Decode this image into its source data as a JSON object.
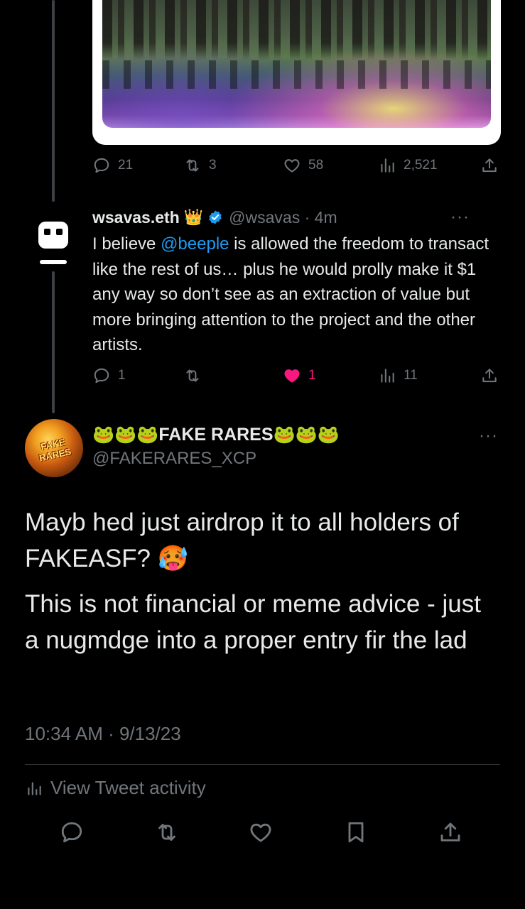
{
  "quoted_tweet_stats": {
    "replies": "21",
    "retweets": "3",
    "likes": "58",
    "views": "2,521"
  },
  "reply_tweet": {
    "display_name": "wsavas.eth",
    "crown_emoji": "👑",
    "handle": "@wsavas",
    "separator": "·",
    "time": "4m",
    "more": "···",
    "text_before_mention": "I believe ",
    "mention": "@beeple",
    "text_after_mention": " is allowed the freedom to transact like the rest of us… plus he would prolly make it $1 any way so don’t see as an extraction of value but more bringing attention to the project and the other artists.",
    "stats": {
      "replies": "1",
      "retweets": "",
      "likes": "1",
      "views": "11"
    }
  },
  "main_tweet": {
    "avatar_text": "FAKE RARES",
    "name_prefix": "🐸🐸🐸",
    "name": "FAKE RARES",
    "name_suffix": "🐸🐸🐸",
    "handle": "@FAKERARES_XCP",
    "more": "···",
    "paragraph_1": "Mayb hed just airdrop it to all holders of FAKEASF? 🥵",
    "paragraph_2": "This is not financial or meme advice - just a nugmdge into a proper entry fir the lad",
    "timestamp": "10:34 AM · 9/13/23",
    "view_activity": "View Tweet activity"
  },
  "colors": {
    "background": "#000000",
    "text": "#e7e9ea",
    "muted": "#71767b",
    "link": "#1d9bf0",
    "like": "#f91880"
  }
}
